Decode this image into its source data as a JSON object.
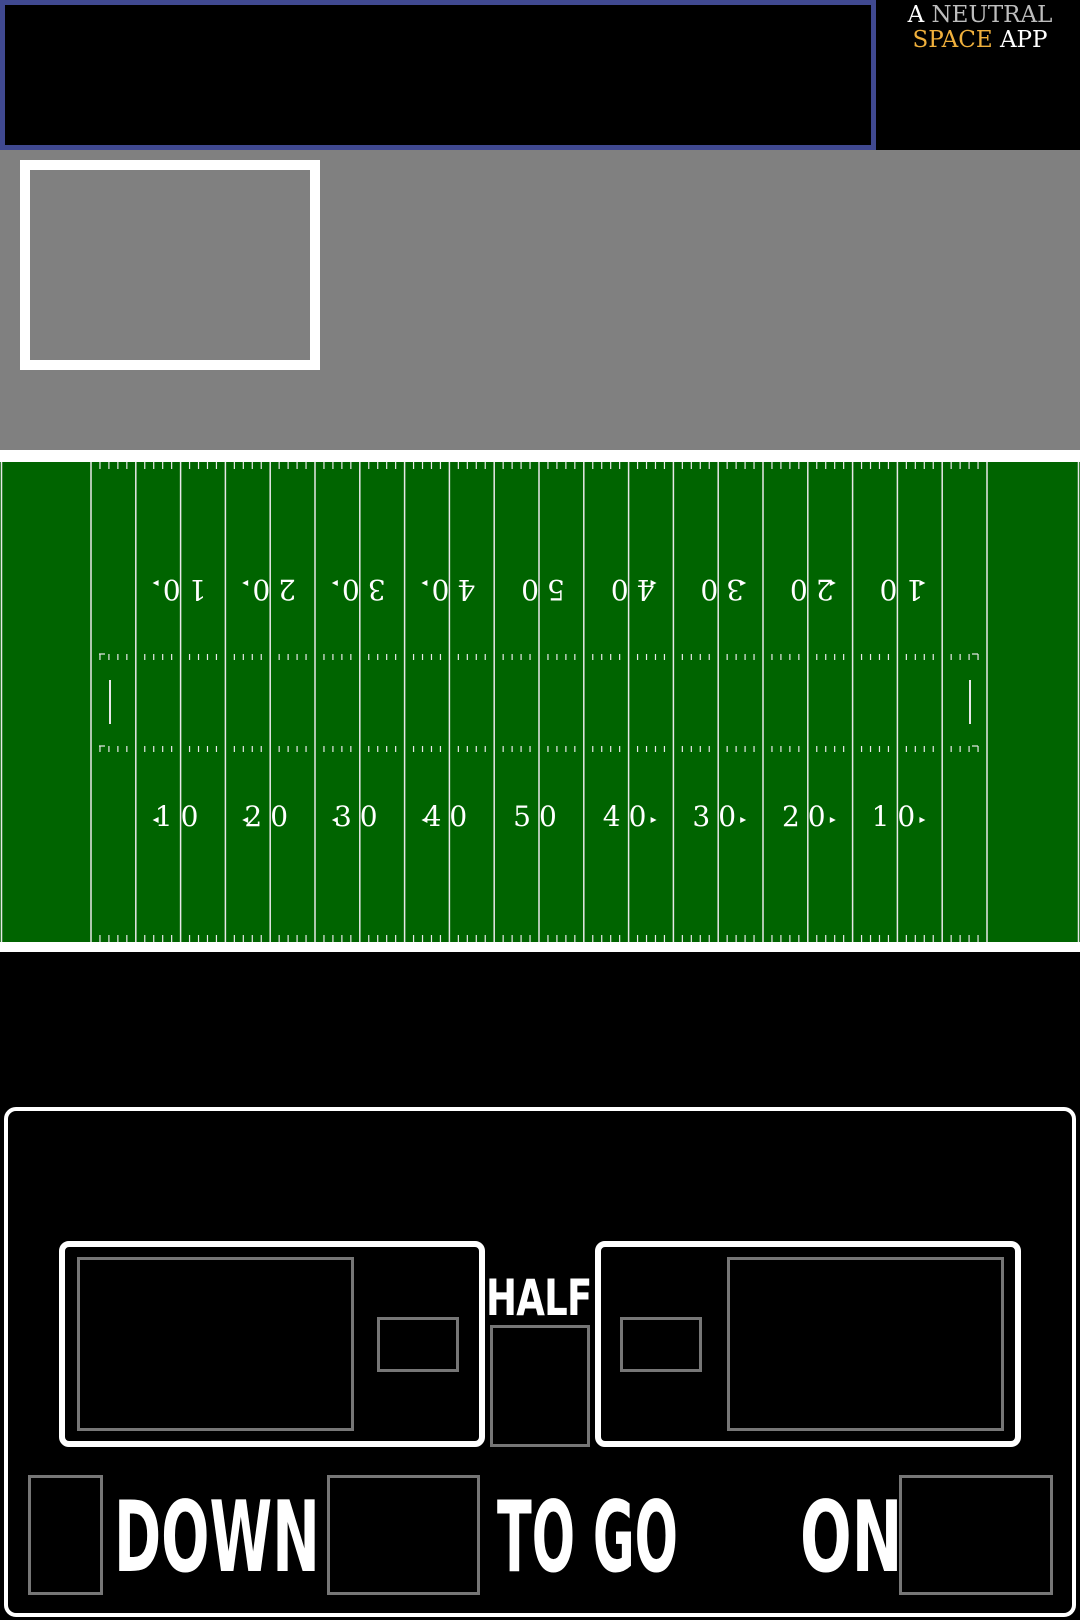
{
  "header": {
    "brand_line1_a": "A",
    "brand_line1_b": "NEUTRAL",
    "brand_line2_a": "SPACE",
    "brand_line2_b": "APP"
  },
  "field": {
    "yard_labels_bottom": [
      "10",
      "20",
      "30",
      "40",
      "50",
      "40",
      "30",
      "20",
      "10"
    ],
    "yard_labels_top": [
      "10",
      "20",
      "30",
      "40",
      "50",
      "40",
      "30",
      "20",
      "10"
    ]
  },
  "scoreboard": {
    "period_label": "HALF",
    "down_label": "DOWN",
    "togo_label": "TO GO",
    "on_label": "ON"
  },
  "colors": {
    "field_green": "#006400",
    "banner_border": "#404990",
    "brand_gold": "#f0b03c"
  }
}
